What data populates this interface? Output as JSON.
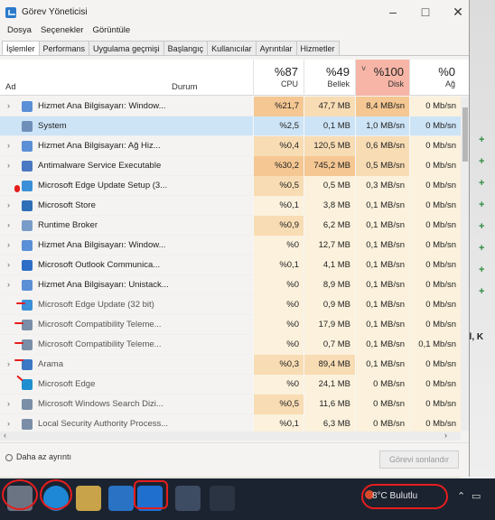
{
  "window": {
    "title": "Görev Yöneticisi"
  },
  "menu": [
    "Dosya",
    "Seçenekler",
    "Görüntüle"
  ],
  "tabs": [
    "İşlemler",
    "Performans",
    "Uygulama geçmişi",
    "Başlangıç",
    "Kullanıcılar",
    "Ayrıntılar",
    "Hizmetler"
  ],
  "columns": {
    "name": "Ad",
    "status": "Durum",
    "cpu": {
      "pct": "%87",
      "label": "CPU"
    },
    "memory": {
      "pct": "%49",
      "label": "Bellek"
    },
    "disk": {
      "pct": "%100",
      "label": "Disk"
    },
    "network": {
      "pct": "%0",
      "label": "Ağ"
    }
  },
  "processes": [
    {
      "name": "Hizmet Ana Bilgisayarı: Window...",
      "cpu": "%21,7",
      "mem": "47,7 MB",
      "disk": "8,4 MB/sn",
      "net": "0 Mb/sn",
      "icon_color": "#5b8fd6",
      "expandable": true
    },
    {
      "name": "System",
      "cpu": "%2,5",
      "mem": "0,1 MB",
      "disk": "1,0 MB/sn",
      "net": "0 Mb/sn",
      "icon_color": "#6d8fb8",
      "expandable": false,
      "selected": true
    },
    {
      "name": "Hizmet Ana Bilgisayarı: Ağ Hiz...",
      "cpu": "%0,4",
      "mem": "120,5 MB",
      "disk": "0,6 MB/sn",
      "net": "0 Mb/sn",
      "icon_color": "#5b8fd6",
      "expandable": true
    },
    {
      "name": "Antimalware Service Executable",
      "cpu": "%30,2",
      "mem": "745,2 MB",
      "disk": "0,5 MB/sn",
      "net": "0 Mb/sn",
      "icon_color": "#4a78c2",
      "expandable": true
    },
    {
      "name": "Microsoft Edge Update Setup (3...",
      "cpu": "%0,5",
      "mem": "0,5 MB",
      "disk": "0,3 MB/sn",
      "net": "0 Mb/sn",
      "icon_color": "#3a8fd8",
      "expandable": false
    },
    {
      "name": "Microsoft Store",
      "cpu": "%0,1",
      "mem": "3,8 MB",
      "disk": "0,1 MB/sn",
      "net": "0 Mb/sn",
      "icon_color": "#2f6fb8",
      "expandable": true
    },
    {
      "name": "Runtime Broker",
      "cpu": "%0,9",
      "mem": "6,2 MB",
      "disk": "0,1 MB/sn",
      "net": "0 Mb/sn",
      "icon_color": "#7a9cc8",
      "expandable": true
    },
    {
      "name": "Hizmet Ana Bilgisayarı: Window...",
      "cpu": "%0",
      "mem": "12,7 MB",
      "disk": "0,1 MB/sn",
      "net": "0 Mb/sn",
      "icon_color": "#5b8fd6",
      "expandable": true
    },
    {
      "name": "Microsoft Outlook Communica...",
      "cpu": "%0,1",
      "mem": "4,1 MB",
      "disk": "0,1 MB/sn",
      "net": "0 Mb/sn",
      "icon_color": "#2d6fc6",
      "expandable": true
    },
    {
      "name": "Hizmet Ana Bilgisayarı: Unistack...",
      "cpu": "%0",
      "mem": "8,9 MB",
      "disk": "0,1 MB/sn",
      "net": "0 Mb/sn",
      "icon_color": "#5b8fd6",
      "expandable": true
    },
    {
      "name": "Microsoft Edge Update (32 bit)",
      "cpu": "%0",
      "mem": "0,9 MB",
      "disk": "0,1 MB/sn",
      "net": "0 Mb/sn",
      "icon_color": "#3a8fd8",
      "expandable": false
    },
    {
      "name": "Microsoft Compatibility Teleme...",
      "cpu": "%0",
      "mem": "17,9 MB",
      "disk": "0,1 MB/sn",
      "net": "0 Mb/sn",
      "icon_color": "#7a8ea8",
      "expandable": false
    },
    {
      "name": "Microsoft Compatibility Teleme...",
      "cpu": "%0",
      "mem": "0,7 MB",
      "disk": "0,1 MB/sn",
      "net": "0,1 Mb/sn",
      "icon_color": "#7a8ea8",
      "expandable": false
    },
    {
      "name": "Arama",
      "cpu": "%0,3",
      "mem": "89,4 MB",
      "disk": "0,1 MB/sn",
      "net": "0 Mb/sn",
      "icon_color": "#3b78c4",
      "expandable": true
    },
    {
      "name": "Microsoft Edge",
      "cpu": "%0",
      "mem": "24,1 MB",
      "disk": "0 MB/sn",
      "net": "0 Mb/sn",
      "icon_color": "#1f8fd0",
      "expandable": false
    },
    {
      "name": "Microsoft Windows Search Dizi...",
      "cpu": "%0,5",
      "mem": "11,6 MB",
      "disk": "0 MB/sn",
      "net": "0 Mb/sn",
      "icon_color": "#7a8ea8",
      "expandable": true
    },
    {
      "name": "Local Security Authority Process...",
      "cpu": "%0,1",
      "mem": "6,3 MB",
      "disk": "0 MB/sn",
      "net": "0 Mb/sn",
      "icon_color": "#7a8ea8",
      "expandable": true
    }
  ],
  "footer": {
    "fewer_details": "Daha az ayrıntı",
    "end_task": "Görevi sonlandır"
  },
  "taskbar": {
    "weather": "8°C  Bulutlu"
  },
  "background_text": "el, K",
  "colors": {
    "disk_header": "#f6b5a6",
    "heat_high": "#f5c792",
    "heat_mid": "#f8dcb4",
    "heat_low": "#fbf1dc",
    "selected_row": "#cde4f7",
    "annotation": "#e61d1d"
  }
}
